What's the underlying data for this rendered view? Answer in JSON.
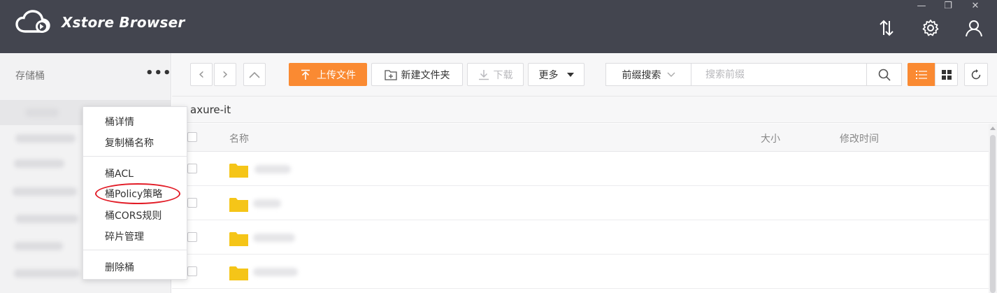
{
  "app": {
    "title": "Xstore Browser"
  },
  "window_controls": {
    "minimize": "—",
    "restore": "❐",
    "close": "✕"
  },
  "header_icons": [
    "transfer-icon",
    "gear-icon",
    "user-icon"
  ],
  "sidebar": {
    "title": "存储桶",
    "more": "•••"
  },
  "context_menu": {
    "items": [
      "桶详情",
      "复制桶名称",
      "桶ACL",
      "桶Policy策略",
      "桶CORS规则",
      "碎片管理",
      "删除桶"
    ],
    "highlighted_item": "桶Policy策略",
    "highlight_color": "#e21c27"
  },
  "toolbar": {
    "back": "‹",
    "forward": "›",
    "up": "︿",
    "upload_label": "上传文件",
    "new_folder_label": "新建文件夹",
    "download_label": "下载",
    "more_label": "更多",
    "search_mode": "前缀搜索",
    "search_placeholder": "搜索前缀",
    "accent_color": "#fa8a32"
  },
  "path": {
    "current": "axure-it"
  },
  "table": {
    "columns": {
      "name": "名称",
      "size": "大小",
      "modified": "修改时间"
    }
  },
  "colors": {
    "titlebar": "#43454f",
    "folder": "#f5c518",
    "sidebar_bg": "#f2f2f3"
  }
}
